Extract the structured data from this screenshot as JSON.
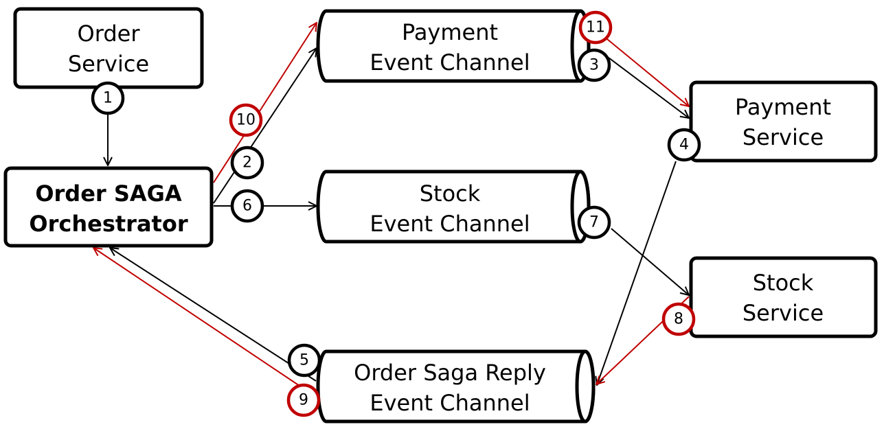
{
  "colors": {
    "normal": "#000000",
    "compensation": "#c00000"
  },
  "nodes": {
    "order_service": {
      "lines": [
        "Order",
        "Service"
      ],
      "type": "service"
    },
    "orchestrator": {
      "lines": [
        "Order SAGA",
        "Orchestrator"
      ],
      "type": "service",
      "bold": true
    },
    "payment_channel": {
      "lines": [
        "Payment",
        "Event Channel"
      ],
      "type": "channel"
    },
    "stock_channel": {
      "lines": [
        "Stock",
        "Event Channel"
      ],
      "type": "channel"
    },
    "reply_channel": {
      "lines": [
        "Order Saga Reply",
        "Event Channel"
      ],
      "type": "channel"
    },
    "payment_service": {
      "lines": [
        "Payment",
        "Service"
      ],
      "type": "service"
    },
    "stock_service": {
      "lines": [
        "Stock",
        "Service"
      ],
      "type": "service"
    }
  },
  "steps": [
    {
      "number": "1",
      "from": "order_service",
      "to": "orchestrator",
      "kind": "normal"
    },
    {
      "number": "2",
      "from": "orchestrator",
      "to": "payment_channel",
      "kind": "normal"
    },
    {
      "number": "3",
      "from": "payment_channel",
      "to": "payment_service",
      "kind": "normal"
    },
    {
      "number": "4",
      "from": "payment_service",
      "to": "reply_channel",
      "kind": "normal"
    },
    {
      "number": "5",
      "from": "reply_channel",
      "to": "orchestrator",
      "kind": "normal"
    },
    {
      "number": "6",
      "from": "orchestrator",
      "to": "stock_channel",
      "kind": "normal"
    },
    {
      "number": "7",
      "from": "stock_channel",
      "to": "stock_service",
      "kind": "normal"
    },
    {
      "number": "8",
      "from": "stock_service",
      "to": "reply_channel",
      "kind": "compensation"
    },
    {
      "number": "9",
      "from": "reply_channel",
      "to": "orchestrator",
      "kind": "compensation"
    },
    {
      "number": "10",
      "from": "orchestrator",
      "to": "payment_channel",
      "kind": "compensation"
    },
    {
      "number": "11",
      "from": "payment_channel",
      "to": "payment_service",
      "kind": "compensation"
    }
  ]
}
